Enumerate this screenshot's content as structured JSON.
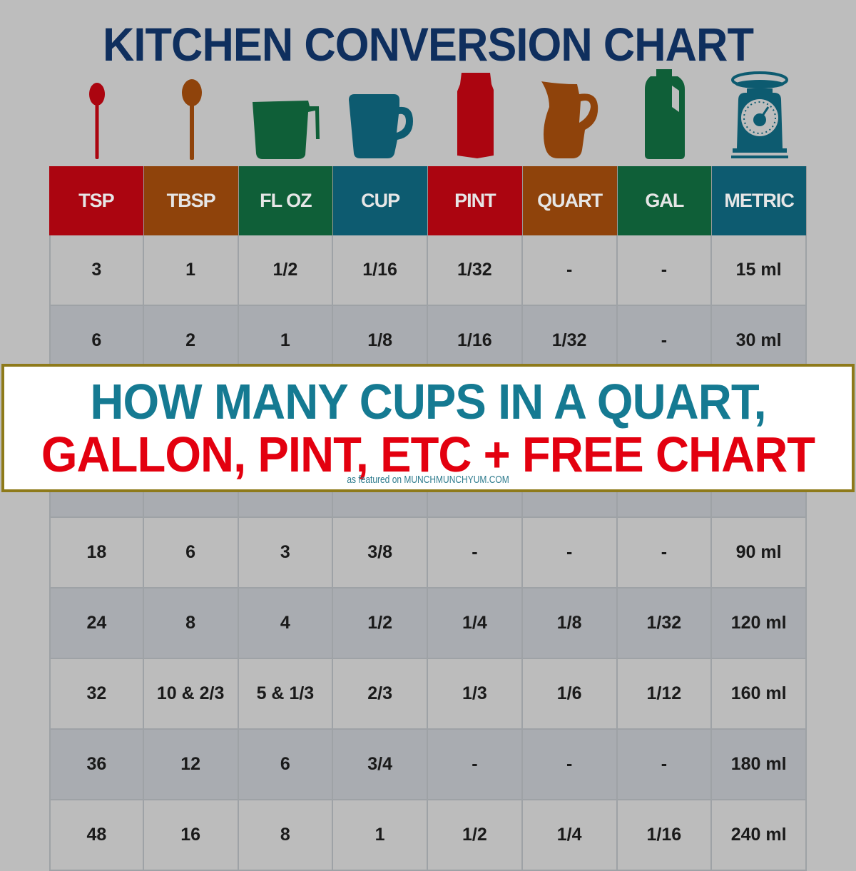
{
  "title": "KITCHEN CONVERSION CHART",
  "colors": {
    "red": "#ab0510",
    "brown": "#8f430b",
    "green": "#0f5f38",
    "teal": "#0d5b70",
    "title_navy": "#0f2f5e",
    "banner_teal": "#157a92",
    "banner_red": "#e3000f",
    "banner_border": "#8e7a1a"
  },
  "icons": [
    {
      "name": "teaspoon-icon",
      "color": "red"
    },
    {
      "name": "tablespoon-icon",
      "color": "brown"
    },
    {
      "name": "measuring-cup-icon",
      "color": "green"
    },
    {
      "name": "mug-icon",
      "color": "teal"
    },
    {
      "name": "milk-carton-icon",
      "color": "red"
    },
    {
      "name": "pitcher-icon",
      "color": "brown"
    },
    {
      "name": "jug-icon",
      "color": "green"
    },
    {
      "name": "kitchen-scale-icon",
      "color": "teal"
    }
  ],
  "chart_data": {
    "type": "table",
    "title": "KITCHEN CONVERSION CHART",
    "columns": [
      "TSP",
      "TBSP",
      "FL OZ",
      "CUP",
      "PINT",
      "QUART",
      "GAL",
      "METRIC"
    ],
    "rows": [
      [
        "3",
        "1",
        "1/2",
        "1/16",
        "1/32",
        "-",
        "-",
        "15 ml"
      ],
      [
        "6",
        "2",
        "1",
        "1/8",
        "1/16",
        "1/32",
        "-",
        "30 ml"
      ],
      [
        "",
        "",
        "",
        "",
        "",
        "",
        "",
        ""
      ],
      [
        "",
        "",
        "",
        "",
        "",
        "",
        "",
        ""
      ],
      [
        "18",
        "6",
        "3",
        "3/8",
        "-",
        "-",
        "-",
        "90 ml"
      ],
      [
        "24",
        "8",
        "4",
        "1/2",
        "1/4",
        "1/8",
        "1/32",
        "120 ml"
      ],
      [
        "32",
        "10 & 2/3",
        "5 & 1/3",
        "2/3",
        "1/3",
        "1/6",
        "1/12",
        "160 ml"
      ],
      [
        "36",
        "12",
        "6",
        "3/4",
        "-",
        "-",
        "-",
        "180 ml"
      ],
      [
        "48",
        "16",
        "8",
        "1",
        "1/2",
        "1/4",
        "1/16",
        "240 ml"
      ]
    ]
  },
  "banner": {
    "line1": "HOW MANY CUPS IN A QUART,",
    "line2": "GALLON, PINT, ETC + FREE CHART",
    "credit": "as featured on MUNCHMUNCHYUM.COM"
  }
}
